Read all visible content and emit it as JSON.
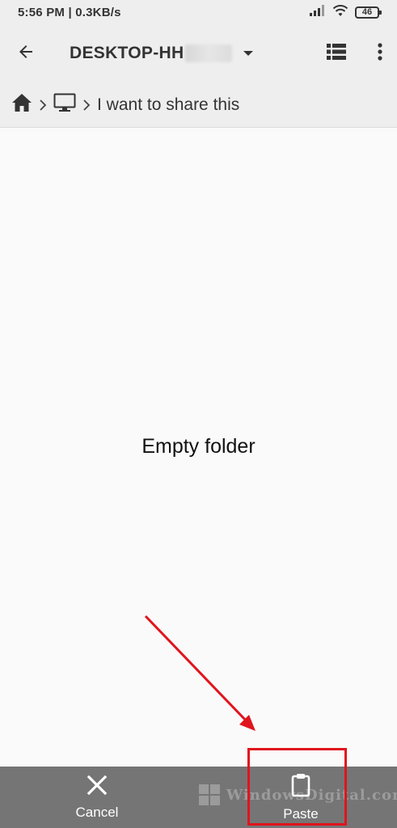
{
  "status_bar": {
    "time_speed": "5:56 PM | 0.3KB/s",
    "battery": "46"
  },
  "app_bar": {
    "title": "DESKTOP-HH",
    "icons": {
      "back": "arrow-back-icon",
      "dropdown": "dropdown-triangle-icon",
      "list_view": "list-view-icon",
      "more": "more-vert-icon"
    }
  },
  "breadcrumb": {
    "items": [
      {
        "icon": "home-icon"
      },
      {
        "icon": "computer-icon"
      },
      {
        "label": "I want to share this"
      }
    ]
  },
  "main": {
    "empty_message": "Empty folder"
  },
  "bottom_bar": {
    "cancel_label": "Cancel",
    "paste_label": "Paste",
    "watermark_text": "WindowsDigital.com"
  },
  "colors": {
    "app_bar_bg": "#eeeeee",
    "bottom_bar_bg": "#757575",
    "annotation_red": "#e0141d"
  }
}
